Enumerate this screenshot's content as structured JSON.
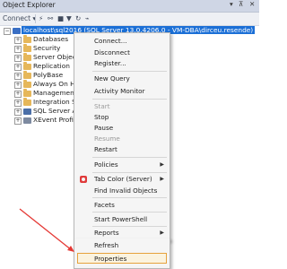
{
  "panel": {
    "title": "Object Explorer",
    "pin_icon": "pin-icon",
    "close_icon": "close-icon",
    "dropdown_icon": "dropdown-icon"
  },
  "toolbar": {
    "connect_label": "Connect ▾",
    "icons": [
      "connect-icon",
      "disconnect-icon",
      "stop-icon",
      "filter-icon",
      "refresh-icon",
      "activity-icon"
    ]
  },
  "tree": {
    "server": {
      "label": "localhost\\sql2016 (SQL Server 13.0.4206.0 - VM-DBA\\dirceu.resende)"
    },
    "nodes": [
      {
        "label": "Databases",
        "icon": "folder-icon"
      },
      {
        "label": "Security",
        "icon": "folder-icon"
      },
      {
        "label": "Server Objects",
        "icon": "folder-icon"
      },
      {
        "label": "Replication",
        "icon": "folder-icon"
      },
      {
        "label": "PolyBase",
        "icon": "folder-icon"
      },
      {
        "label": "Always On High",
        "icon": "folder-icon"
      },
      {
        "label": "Management",
        "icon": "folder-icon"
      },
      {
        "label": "Integration Servi",
        "icon": "folder-icon"
      },
      {
        "label": "SQL Server Agen",
        "icon": "agent-icon"
      },
      {
        "label": "XEvent Profiler",
        "icon": "profiler-icon"
      }
    ]
  },
  "menu": {
    "items": [
      {
        "label": "Connect..."
      },
      {
        "label": "Disconnect"
      },
      {
        "label": "Register..."
      },
      {
        "label": "New Query"
      },
      {
        "label": "Activity Monitor"
      },
      {
        "label": "Start"
      },
      {
        "label": "Stop"
      },
      {
        "label": "Pause"
      },
      {
        "label": "Resume"
      },
      {
        "label": "Restart"
      },
      {
        "label": "Policies"
      },
      {
        "label": "Tab Color (Server)"
      },
      {
        "label": "Find Invalid Objects"
      },
      {
        "label": "Facets"
      },
      {
        "label": "Start PowerShell"
      },
      {
        "label": "Reports"
      },
      {
        "label": "Refresh"
      },
      {
        "label": "Properties"
      }
    ]
  },
  "colors": {
    "selection": "#1b6fd6",
    "highlight_border": "#e6a23c",
    "annotation_arrow": "#e53935"
  }
}
